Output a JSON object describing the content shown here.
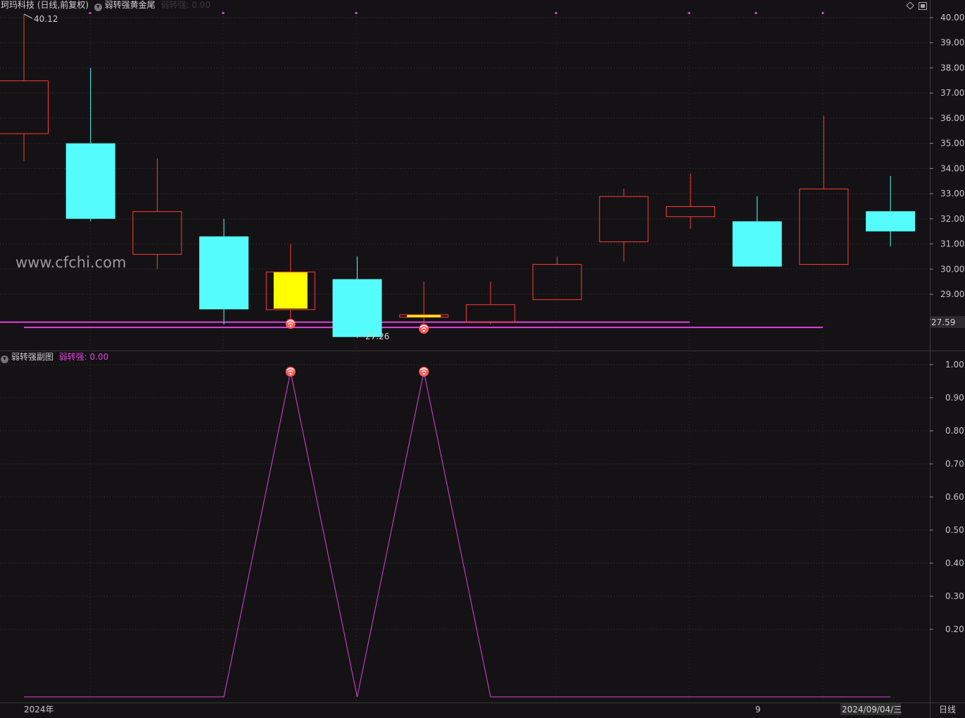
{
  "header": {
    "stock_title": "珂玛科技 (日线,前复权)",
    "main_indicator_name": "弱转强黄金尾",
    "main_indicator_value": "弱转强: 0.00"
  },
  "sub_header": {
    "indicator_name": "弱转强副图",
    "indicator_value": "弱转强: 0.00"
  },
  "watermark": "www.cfchi.com",
  "annotations": {
    "high_label": "40.12",
    "low_label": "27.26",
    "current_price": "27.59"
  },
  "time_axis": {
    "labels": [
      "2024年",
      "9",
      "2024/09/04/三"
    ],
    "period_button": "日线"
  },
  "colors": {
    "background": "#141214",
    "up": "#ff3b3b",
    "down": "#54fcfc",
    "signal": "#ffff00",
    "indicator": "#e040e0",
    "support_line": "#e040e0"
  },
  "chart_data": [
    {
      "type": "candlestick",
      "y_axis_ticks": [
        "40.00",
        "39.00",
        "38.00",
        "37.00",
        "36.00",
        "35.00",
        "34.00",
        "33.00",
        "32.00",
        "31.00",
        "30.00",
        "29.00"
      ],
      "ylim": [
        27.1,
        40.3
      ],
      "candles": [
        {
          "open": 35.4,
          "close": 37.5,
          "high": 40.12,
          "low": 34.3,
          "dir": "up"
        },
        {
          "open": 35.0,
          "close": 32.0,
          "high": 38.0,
          "low": 31.9,
          "dir": "down"
        },
        {
          "open": 30.6,
          "close": 32.3,
          "high": 34.4,
          "low": 30.0,
          "dir": "up"
        },
        {
          "open": 31.3,
          "close": 28.4,
          "high": 32.0,
          "low": 27.8,
          "dir": "down"
        },
        {
          "open": 28.4,
          "close": 29.9,
          "high": 31.0,
          "low": 28.0,
          "dir": "up",
          "signal": true
        },
        {
          "open": 29.6,
          "close": 27.3,
          "high": 30.5,
          "low": 27.26,
          "dir": "down"
        },
        {
          "open": 28.1,
          "close": 28.2,
          "high": 29.5,
          "low": 27.7,
          "dir": "up",
          "signal": true
        },
        {
          "open": 27.9,
          "close": 28.6,
          "high": 29.5,
          "low": 27.8,
          "dir": "up"
        },
        {
          "open": 28.8,
          "close": 30.2,
          "high": 30.5,
          "low": 28.8,
          "dir": "up"
        },
        {
          "open": 31.1,
          "close": 32.9,
          "high": 33.2,
          "low": 30.3,
          "dir": "up"
        },
        {
          "open": 32.1,
          "close": 32.5,
          "high": 33.8,
          "low": 31.6,
          "dir": "up"
        },
        {
          "open": 31.9,
          "close": 30.1,
          "high": 32.9,
          "low": 30.1,
          "dir": "down"
        },
        {
          "open": 30.2,
          "close": 33.2,
          "high": 36.1,
          "low": 30.2,
          "dir": "up"
        },
        {
          "open": 32.3,
          "close": 31.5,
          "high": 33.7,
          "low": 30.9,
          "dir": "down"
        }
      ],
      "support_lines": [
        27.89,
        27.68
      ]
    },
    {
      "type": "line",
      "name": "弱转强",
      "y_axis_ticks": [
        "1.00",
        "0.90",
        "0.80",
        "0.70",
        "0.60",
        "0.50",
        "0.40",
        "0.30",
        "0.20"
      ],
      "ylim": [
        0,
        1
      ],
      "values": [
        0,
        0,
        0,
        0,
        1,
        0,
        1,
        0,
        0,
        0,
        0,
        0,
        0,
        0
      ]
    }
  ]
}
